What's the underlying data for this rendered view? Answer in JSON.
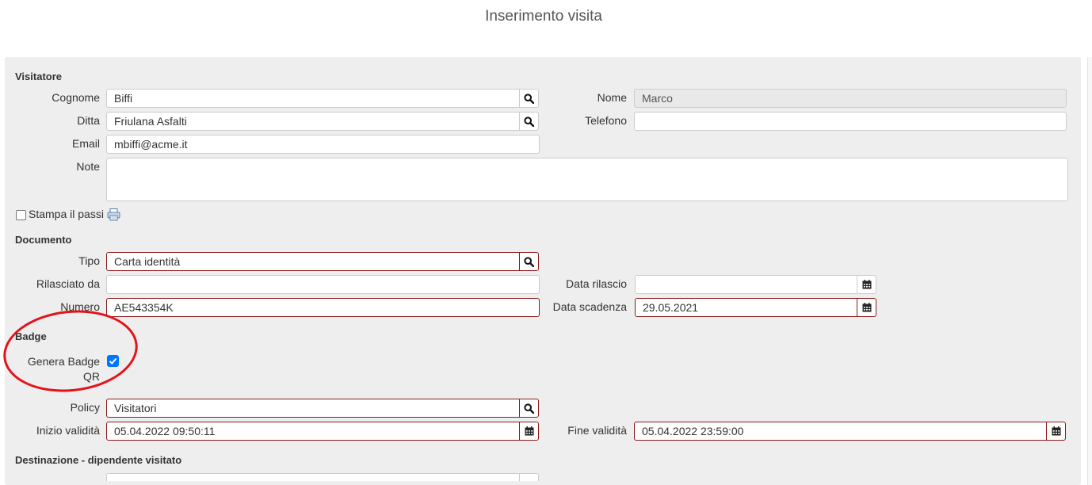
{
  "page": {
    "title": "Inserimento visita"
  },
  "visitatore": {
    "section_title": "Visitatore",
    "cognome_label": "Cognome",
    "cognome_value": "Biffi",
    "nome_label": "Nome",
    "nome_value": "Marco",
    "ditta_label": "Ditta",
    "ditta_value": "Friulana Asfalti",
    "telefono_label": "Telefono",
    "telefono_value": "",
    "email_label": "Email",
    "email_value": "mbiffi@acme.it",
    "note_label": "Note",
    "note_value": "",
    "stampa_label": "Stampa il passi",
    "stampa_checked": false
  },
  "documento": {
    "section_title": "Documento",
    "tipo_label": "Tipo",
    "tipo_value": "Carta identità",
    "rilasciato_label": "Rilasciato da",
    "rilasciato_value": "",
    "data_rilascio_label": "Data rilascio",
    "data_rilascio_value": "",
    "numero_label": "Numero",
    "numero_value": "AE543354K",
    "data_scadenza_label": "Data scadenza",
    "data_scadenza_value": "29.05.2021"
  },
  "badge": {
    "section_title": "Badge",
    "genera_label_line1": "Genera Badge",
    "genera_label_line2": "QR",
    "genera_checked": true,
    "policy_label": "Policy",
    "policy_value": "Visitatori",
    "inizio_label": "Inizio validità",
    "inizio_value": "05.04.2022 09:50:11",
    "fine_label": "Fine validità",
    "fine_value": "05.04.2022 23:59:00"
  },
  "destinazione": {
    "section_title": "Destinazione - dipendente visitato"
  },
  "colors": {
    "required_border": "#8b1a1a",
    "highlight_circle": "#e2131a",
    "checkbox_blue": "#0075ff"
  },
  "icons": {
    "search": "search-icon",
    "calendar": "calendar-icon",
    "printer": "printer-icon"
  }
}
